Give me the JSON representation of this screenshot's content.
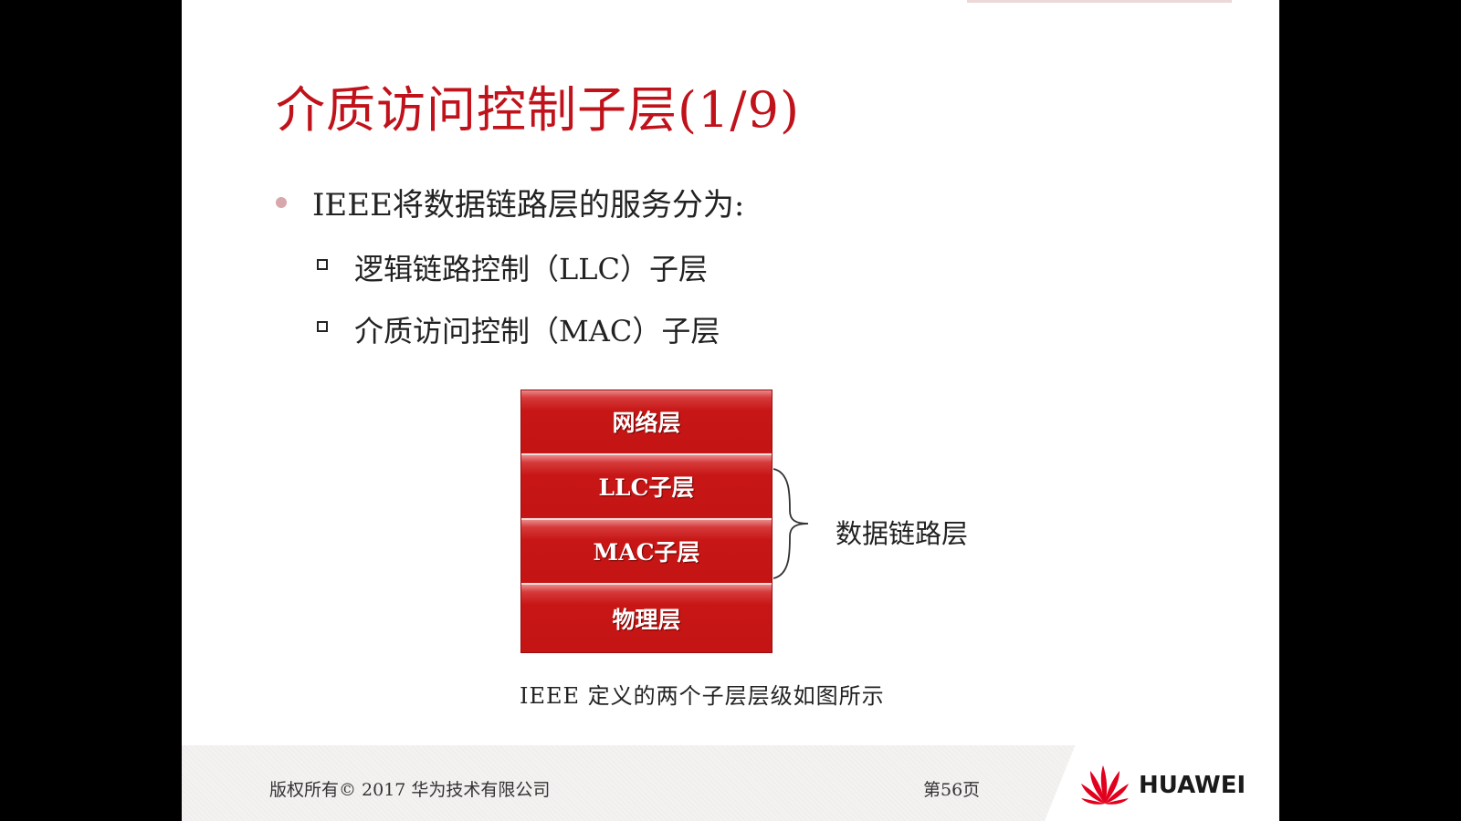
{
  "slide": {
    "title": "介质访问控制子层(1/9)",
    "bullet": "IEEE将数据链路层的服务分为:",
    "sub_items": [
      "逻辑链路控制（LLC）子层",
      "介质访问控制（MAC）子层"
    ]
  },
  "diagram": {
    "layers": [
      "网络层",
      "LLC子层",
      "MAC子层",
      "物理层"
    ],
    "brace_label": "数据链路层",
    "caption": "IEEE 定义的两个子层层级如图所示",
    "layer_color": "#c41414"
  },
  "footer": {
    "copyright": "版权所有© 2017 华为技术有限公司",
    "page": "第56页",
    "logo_text": "HUAWEI"
  },
  "colors": {
    "title": "#c0121a",
    "background": "#000000",
    "logo_red": "#e1001e"
  }
}
